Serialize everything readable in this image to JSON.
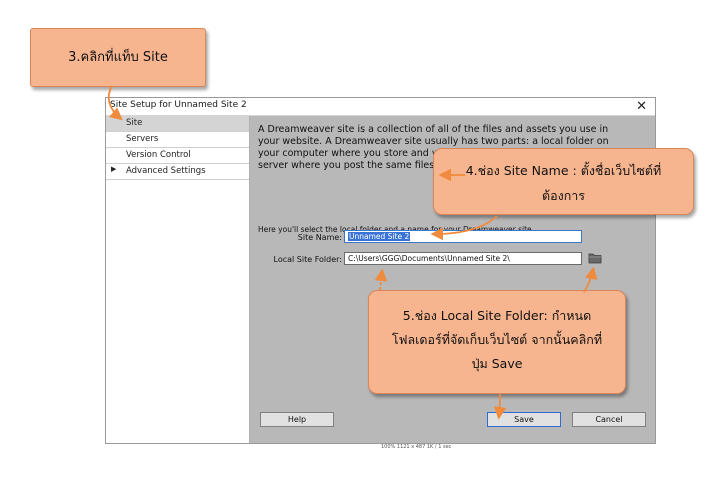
{
  "dialog": {
    "title": "Site Setup for Unnamed Site 2",
    "close_glyph": "✕",
    "sidebar": [
      {
        "label": "Site",
        "selected": true,
        "expander": ""
      },
      {
        "label": "Servers",
        "selected": false,
        "expander": ""
      },
      {
        "label": "Version Control",
        "selected": false,
        "expander": ""
      },
      {
        "label": "Advanced Settings",
        "selected": false,
        "expander": "▶"
      }
    ],
    "intro_text": "A Dreamweaver site is a collection of all of the files and assets you use in your website. A Dreamweaver site usually has two parts: a local folder on your computer where you store and work on files, and a remote folder on a server where you post the same files to the web.",
    "hint_text": "Here you'll select the local folder and a name for your Dreamweaver site.",
    "site_name_label": "Site Name:",
    "site_name_value": "Unnamed Site 2",
    "local_folder_label": "Local Site Folder:",
    "local_folder_value": "C:\\Users\\GGG\\Documents\\Unnamed Site 2\\",
    "folder_icon": "folder-icon",
    "help_label": "Help",
    "save_label": "Save",
    "cancel_label": "Cancel"
  },
  "callouts": {
    "step3": "3.คลิกที่แท็บ Site",
    "step4_line1": "4.ช่อง Site Name : ตั้งชื่อเว็บไซต์ที่",
    "step4_line2": "ต้องการ",
    "step5_line1": "5.ช่อง Local Site Folder: กำหนด",
    "step5_line2": "โฟลเดอร์ที่จัดเก็บเว็บไซต์ จากนั้นคลิกที่",
    "step5_line3": "ปุ่ม Save"
  },
  "status_strip": "100%   1121 x 487   1K / 1 sec",
  "colors": {
    "callout_fill": "#f7b58f",
    "arrow": "#f08a3c",
    "selection": "#3b74d6"
  }
}
